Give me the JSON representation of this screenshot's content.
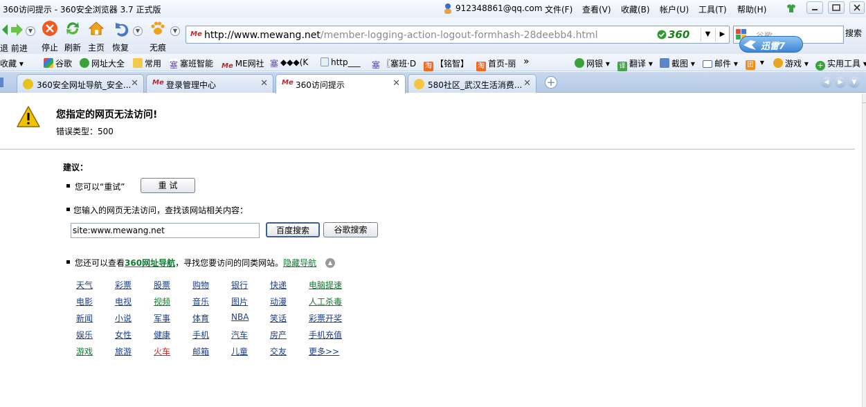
{
  "window": {
    "title": "360访问提示 - 360安全浏览器 3.7 正式版",
    "account": "912348861@qq.com",
    "menu": [
      "文件(F)",
      "查看(V)",
      "收藏(B)",
      "帐户(U)",
      "工具(T)",
      "帮助(H)"
    ]
  },
  "toolbar": {
    "back_forward_label": "退 前进",
    "stop_label": "停止",
    "refresh_label": "刷新",
    "home_label": "主页",
    "restore_label": "恢复",
    "incognito_label": "无痕",
    "address_domain": "http://www.mewang.net",
    "address_path": "/member-logging-action-logout-formhash-28deebb4.html",
    "badge_360": "360",
    "search_placeholder": "谷歌",
    "search_button": "搜索",
    "xunlei_label": "迅雷7"
  },
  "favorites": {
    "items": [
      "收藏",
      "谷歌",
      "网址大全",
      "常用",
      "塞班智能",
      "ME网社",
      "◆◆◆(K",
      "http___",
      "〖塞班·D",
      "【铭智】",
      "首页-丽"
    ],
    "more": "»",
    "right_items": [
      "网银",
      "翻译",
      "截图",
      "邮件",
      "",
      "游戏",
      "实用工具"
    ]
  },
  "tabs": [
    {
      "label": "360安全网址导航_安全...",
      "active": false
    },
    {
      "label": "登录管理中心",
      "active": false
    },
    {
      "label": "360访问提示",
      "active": true
    },
    {
      "label": "580社区_武汉生活消费...",
      "active": false
    }
  ],
  "page": {
    "heading": "您指定的网页无法访问!",
    "error_type": "错误类型：500",
    "suggest_title": "建议：",
    "retry_text": "您可以“重试”",
    "retry_button": "重 试",
    "search_hint": "您输入的网页无法访问，查找该网站相关内容：",
    "search_value": "site:www.mewang.net",
    "baidu_button": "百度搜索",
    "google_button": "谷歌搜索",
    "nav_prefix": "您还可以查看",
    "nav_link": "360网址导航",
    "nav_suffix": "，寻找您要访问的同类网站。",
    "hide_nav": "隐藏导航",
    "categories": [
      [
        "天气",
        "彩票",
        "股票",
        "购物",
        "银行",
        "快递",
        "电脑提速"
      ],
      [
        "电影",
        "电视",
        "视频",
        "音乐",
        "图片",
        "动漫",
        "人工杀毒"
      ],
      [
        "新闻",
        "小说",
        "军事",
        "体育",
        "NBA",
        "笑话",
        "彩票开奖"
      ],
      [
        "娱乐",
        "女性",
        "健康",
        "手机",
        "汽车",
        "房产",
        "手机充值"
      ],
      [
        "游戏",
        "旅游",
        "火车",
        "邮箱",
        "儿童",
        "交友",
        "更多>>"
      ]
    ],
    "colors": {
      "link": "#1a3e8c",
      "green_link": "#0f7a2e",
      "red_link": "#d42020",
      "warning": "#f2c200"
    }
  }
}
